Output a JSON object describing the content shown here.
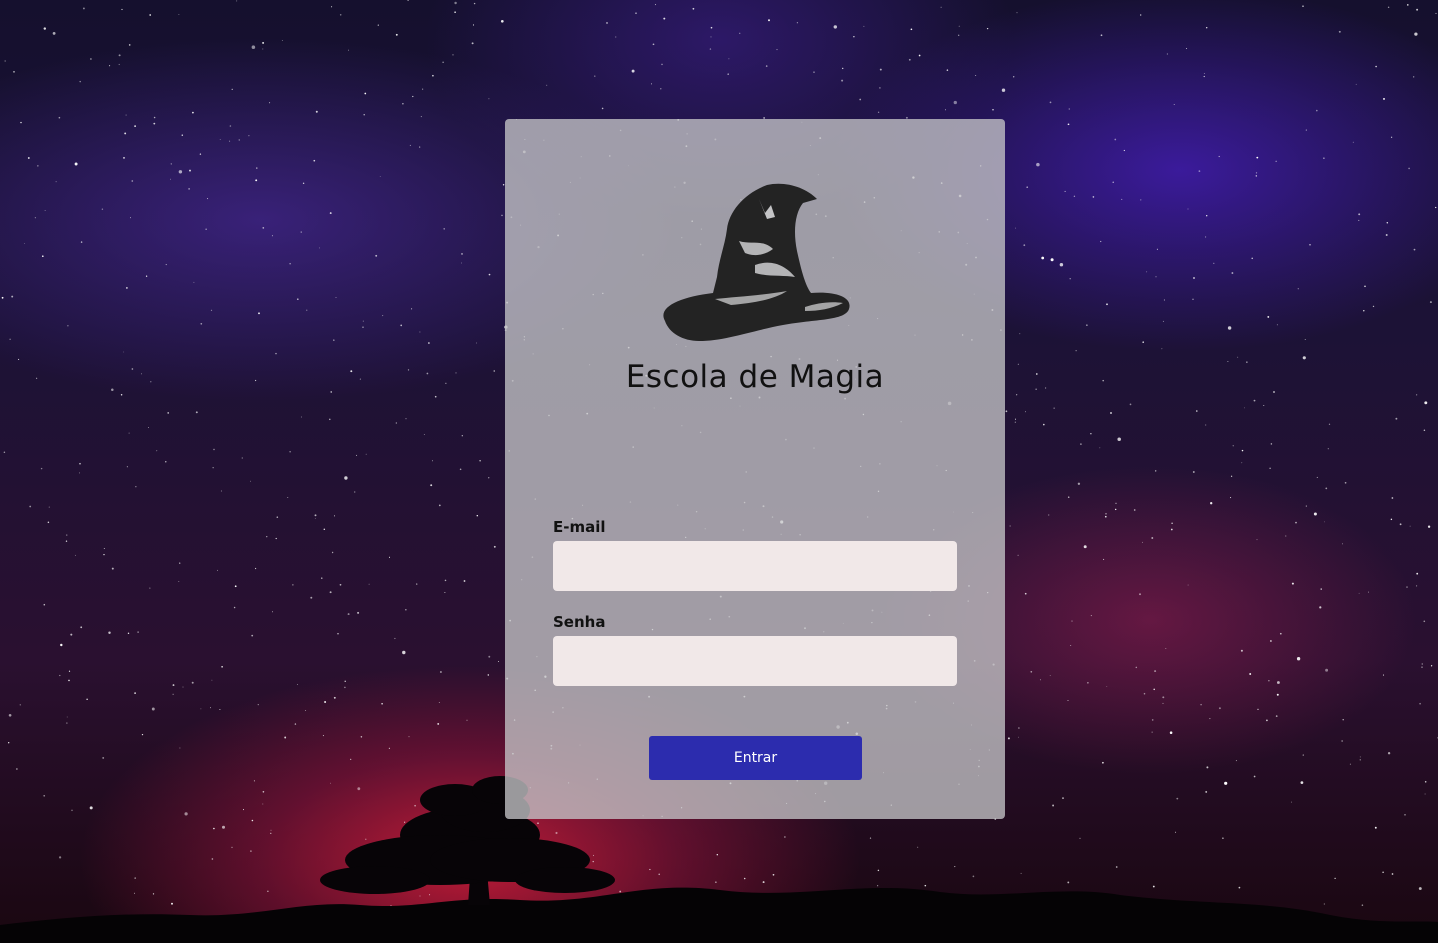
{
  "login": {
    "title": "Escola de Magia",
    "email_label": "E-mail",
    "email_value": "",
    "password_label": "Senha",
    "password_value": "",
    "submit_label": "Entrar"
  },
  "icons": {
    "logo": "sorting-hat-icon"
  },
  "colors": {
    "button": "#2c2cae",
    "input_background": "#f1e8e8",
    "card_background": "#c4c4c6"
  }
}
